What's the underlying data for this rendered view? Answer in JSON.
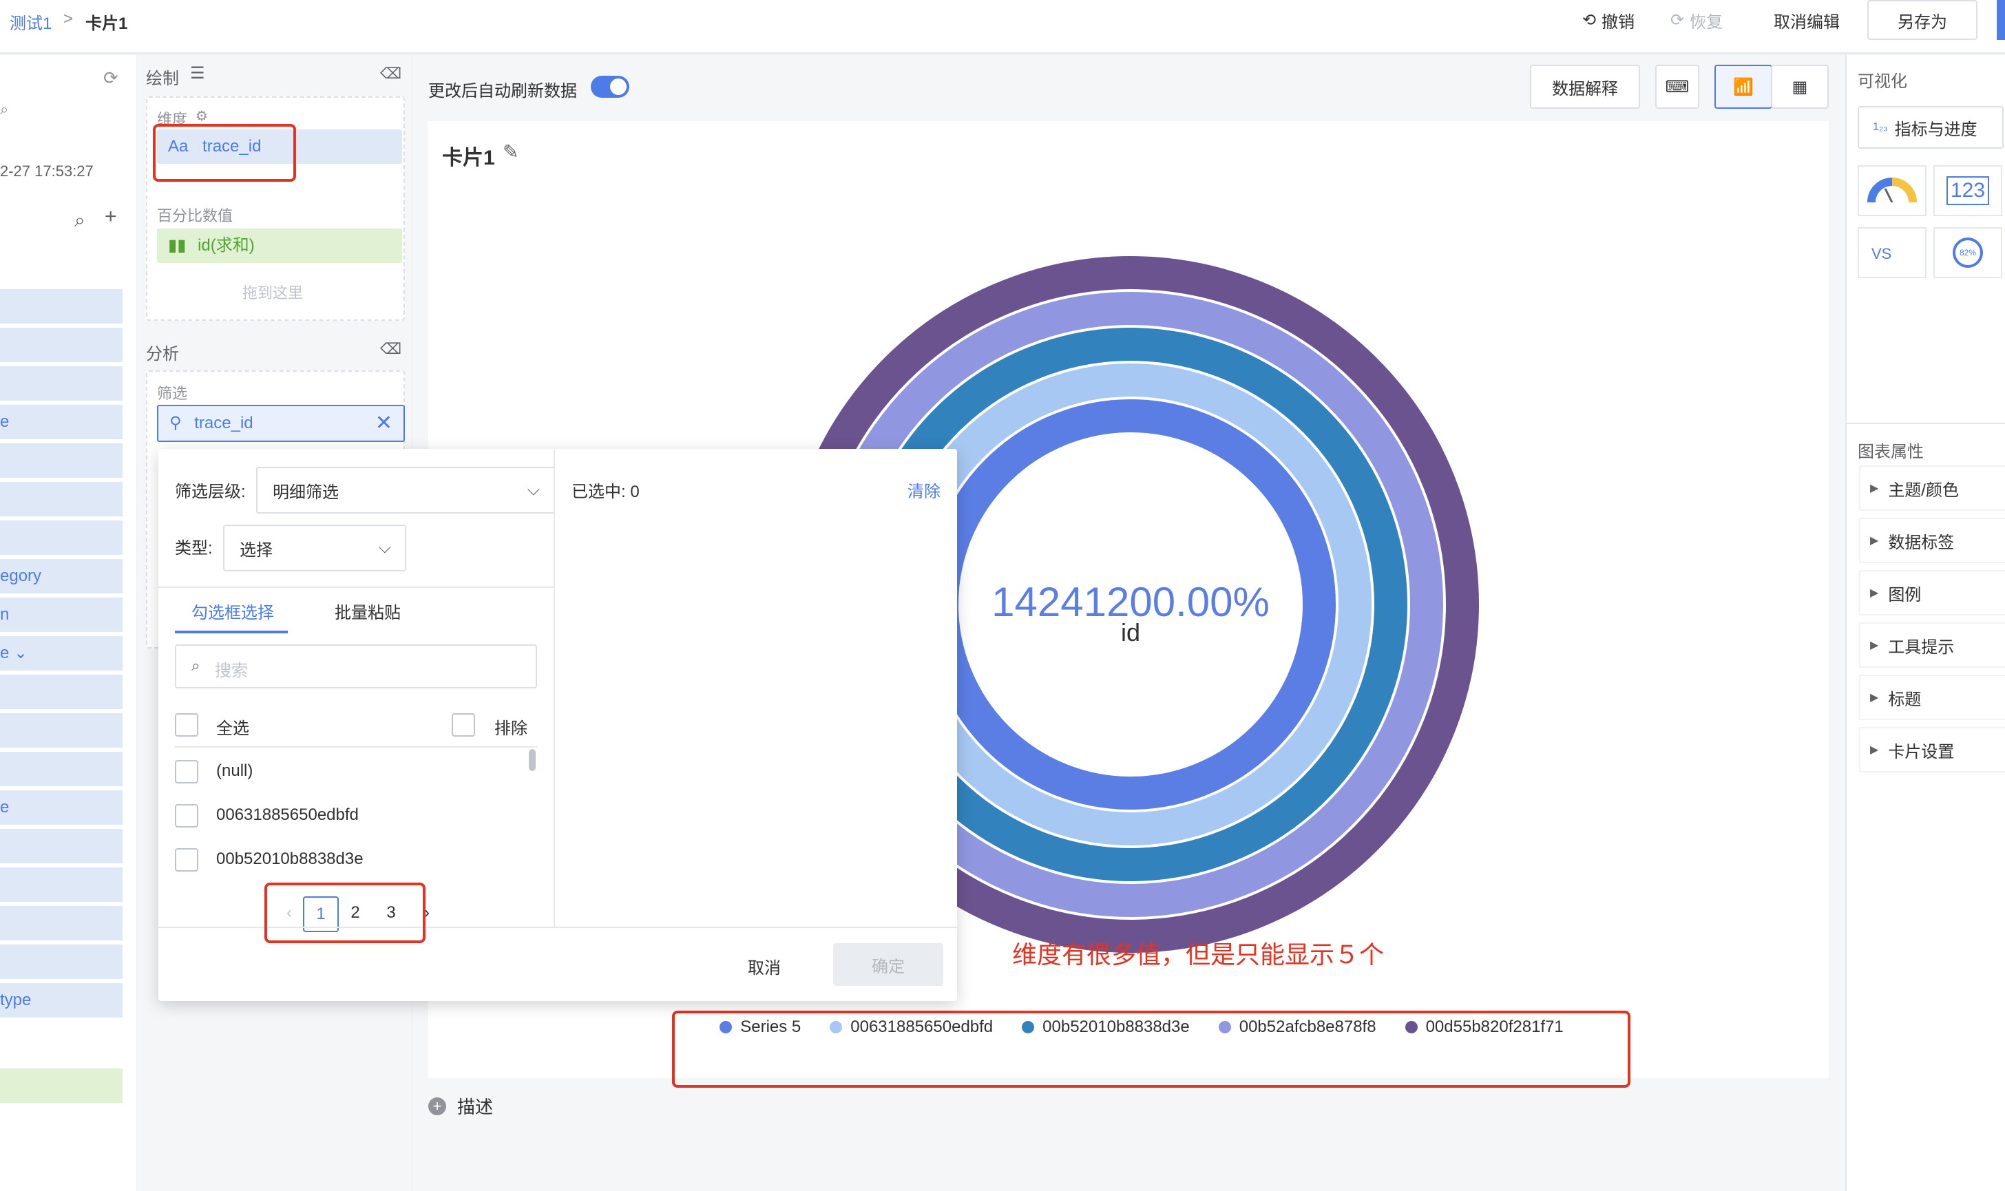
{
  "header": {
    "breadcrumb_root": "测试1",
    "breadcrumb_sep": ">",
    "breadcrumb_current": "卡片1",
    "undo_label": "撤销",
    "redo_label": "恢复",
    "cancel_edit_label": "取消编辑",
    "save_as_label": "另存为"
  },
  "left_panel": {
    "timestamp": "2-27 17:53:27",
    "field_fragments": [
      "e",
      "egory",
      "n",
      "e ⌄",
      "e",
      "type"
    ]
  },
  "draw": {
    "title": "绘制",
    "dimension_label": "维度",
    "dimension_chip": "trace_id",
    "dimension_chip_prefix": "Aa",
    "percent_label": "百分比数值",
    "percent_chip": "id(求和)",
    "drop_here": "拖到这里",
    "analysis_title": "分析",
    "filter_label": "筛选",
    "filter_chip": "trace_id"
  },
  "toolbar": {
    "auto_refresh_label": "更改后自动刷新数据",
    "auto_refresh_on": true,
    "data_explain_label": "数据解释"
  },
  "card": {
    "title": "卡片1",
    "center_value": "14241200.00%",
    "center_label": "id",
    "annotation": "维度有很多值，但是只能显示５个",
    "describe_label": "描述"
  },
  "chart_data": {
    "type": "radial-bar",
    "series": [
      {
        "name": "Series 5",
        "color": "#5b7ee5"
      },
      {
        "name": "00631885650edbfd",
        "color": "#a7c8f2"
      },
      {
        "name": "00b52010b8838d3e",
        "color": "#3182bd"
      },
      {
        "name": "00b52afcb8e878f8",
        "color": "#9097e0"
      },
      {
        "name": "00d55b820f281f71",
        "color": "#6b538f"
      }
    ],
    "legend_position": "bottom"
  },
  "filter_popover": {
    "level_label": "筛选层级:",
    "level_value": "明细筛选",
    "type_label": "类型:",
    "type_value": "选择",
    "tab_checkbox": "勾选框选择",
    "tab_paste": "批量粘贴",
    "search_placeholder": "搜索",
    "select_all": "全选",
    "exclude": "排除",
    "options": [
      "(null)",
      "00631885650edbfd",
      "00b52010b8838d3e"
    ],
    "pages": [
      "1",
      "2",
      "3"
    ],
    "current_page": "1",
    "selected_count": "已选中: 0",
    "clear_label": "清除",
    "cancel_label": "取消",
    "confirm_label": "确定"
  },
  "right_panel": {
    "visualization_title": "可视化",
    "metric_progress_label": "指标与进度",
    "chart_props_title": "图表属性",
    "props": [
      "主题/颜色",
      "数据标签",
      "图例",
      "工具提示",
      "标题",
      "卡片设置"
    ],
    "metric_text": "123",
    "vs_text": "VS",
    "percent_icon_text": "82%"
  },
  "colors": {
    "accent": "#4e7ce6",
    "annotation_red": "#e53321"
  }
}
